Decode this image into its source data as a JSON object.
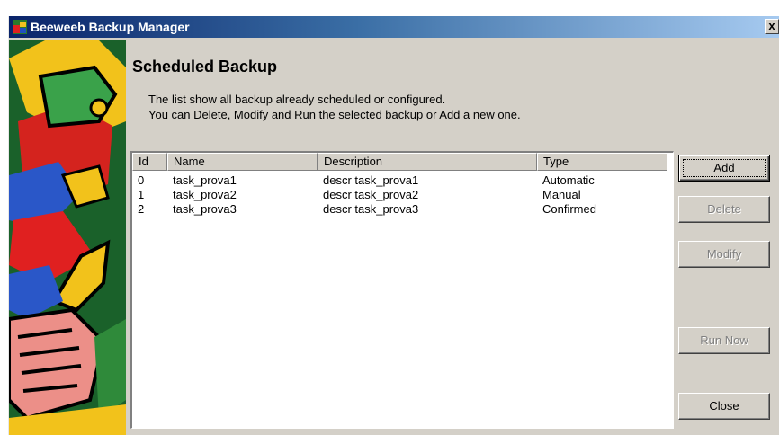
{
  "window": {
    "title": "Beeweeb Backup Manager",
    "close_glyph": "x"
  },
  "heading": "Scheduled Backup",
  "description": {
    "line1": "The list show all backup already scheduled or configured.",
    "line2": "You can Delete, Modify and Run the selected backup or Add a new one."
  },
  "table": {
    "columns": [
      "Id",
      "Name",
      "Description",
      "Type"
    ],
    "rows": [
      [
        "0",
        "task_prova1",
        "descr task_prova1",
        "Automatic"
      ],
      [
        "1",
        "task_prova2",
        "descr task_prova2",
        "Manual"
      ],
      [
        "2",
        "task_prova3",
        "descr task_prova3",
        "Confirmed"
      ]
    ]
  },
  "buttons": {
    "add": "Add",
    "delete": "Delete",
    "modify": "Modify",
    "run_now": "Run Now",
    "close": "Close"
  },
  "colors": {
    "titlebar_start": "#0a246a",
    "titlebar_end": "#a6caf0",
    "dialog_bg": "#d4d0c8"
  },
  "icons": {
    "app": "app-logo-icon",
    "close": "close-icon"
  }
}
